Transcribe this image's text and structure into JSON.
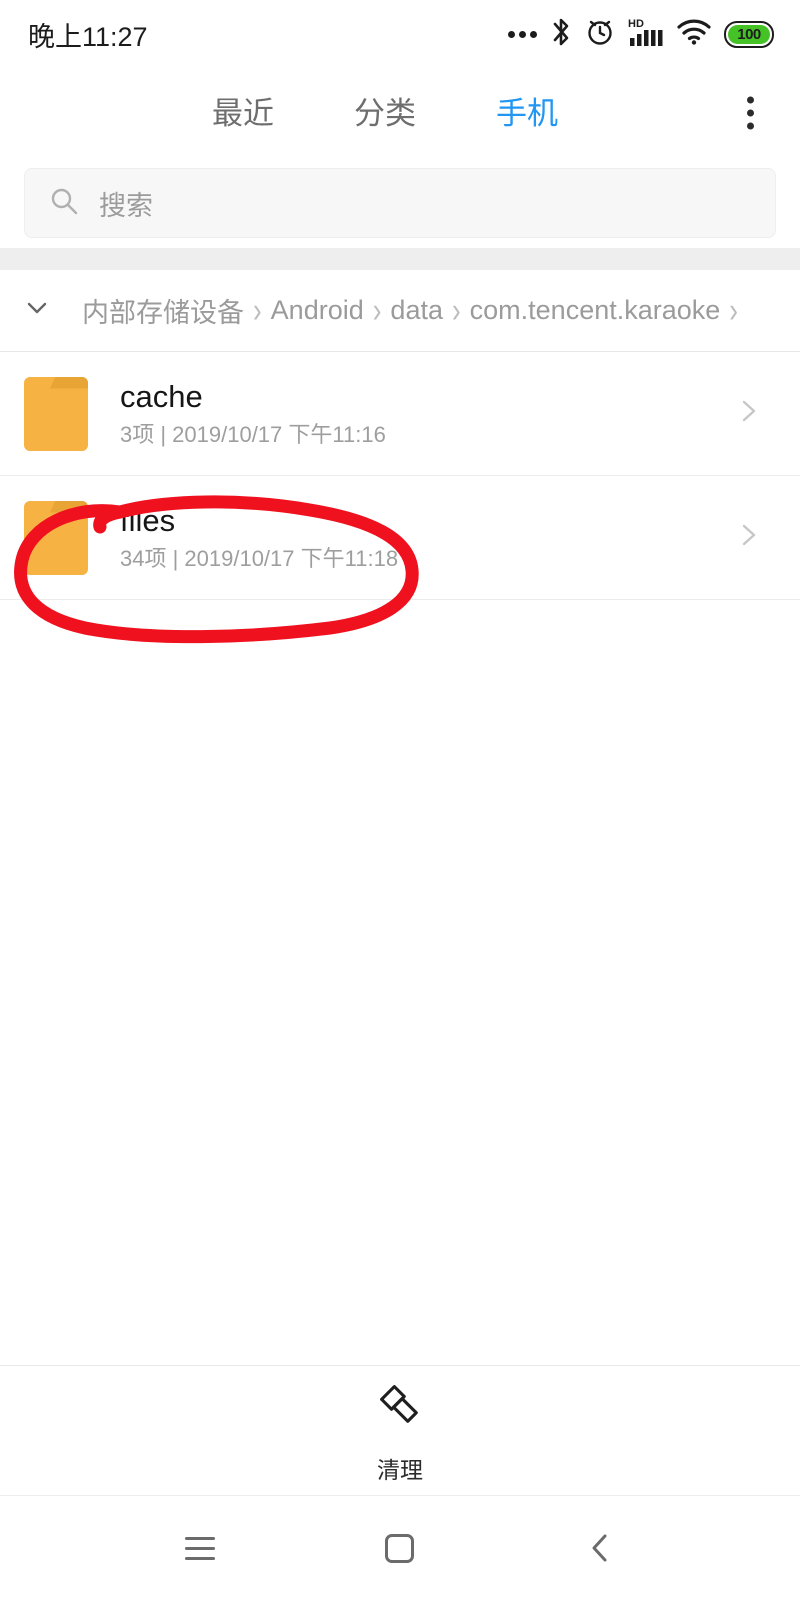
{
  "status_bar": {
    "time": "晚上11:27",
    "icons": [
      "more-dots-icon",
      "bluetooth-icon",
      "alarm-icon",
      "hd-signal-icon",
      "wifi-icon",
      "battery-icon"
    ],
    "battery_level": "100"
  },
  "tabs": [
    {
      "label": "最近",
      "active": false,
      "name": "tab-recent"
    },
    {
      "label": "分类",
      "active": false,
      "name": "tab-categories"
    },
    {
      "label": "手机",
      "active": true,
      "name": "tab-phone"
    }
  ],
  "search": {
    "placeholder": "搜索",
    "value": ""
  },
  "breadcrumb": {
    "crumbs": [
      "内部存储设备",
      "Android",
      "data",
      "com.tencent.karaoke"
    ],
    "separator": "›",
    "trailing_separator": "›"
  },
  "files": [
    {
      "name": "cache",
      "meta": "3项 | 2019/10/17 下午11:16",
      "count": "3项",
      "modified": "2019/10/17 下午11:16",
      "type": "folder",
      "annotated": false
    },
    {
      "name": "files",
      "meta": "34项 | 2019/10/17 下午11:18",
      "count": "34项",
      "modified": "2019/10/17 下午11:18",
      "type": "folder",
      "annotated": true
    }
  ],
  "bottom_action": {
    "label": "清理",
    "icon": "brush-clean-icon"
  },
  "nav_bar": {
    "menu": "menu-icon",
    "home": "home-icon",
    "back": "back-icon"
  },
  "colors": {
    "accent_blue": "#2196f3",
    "folder_orange": "#f7b244",
    "folder_orange_dark": "#e9a436",
    "annotation_red": "#f0111f",
    "battery_green": "#45c226",
    "text_primary": "#161616",
    "text_secondary": "#9e9e9e",
    "divider": "#ececec",
    "search_bg": "#f7f7f7",
    "band_gray": "#eeeeee"
  }
}
